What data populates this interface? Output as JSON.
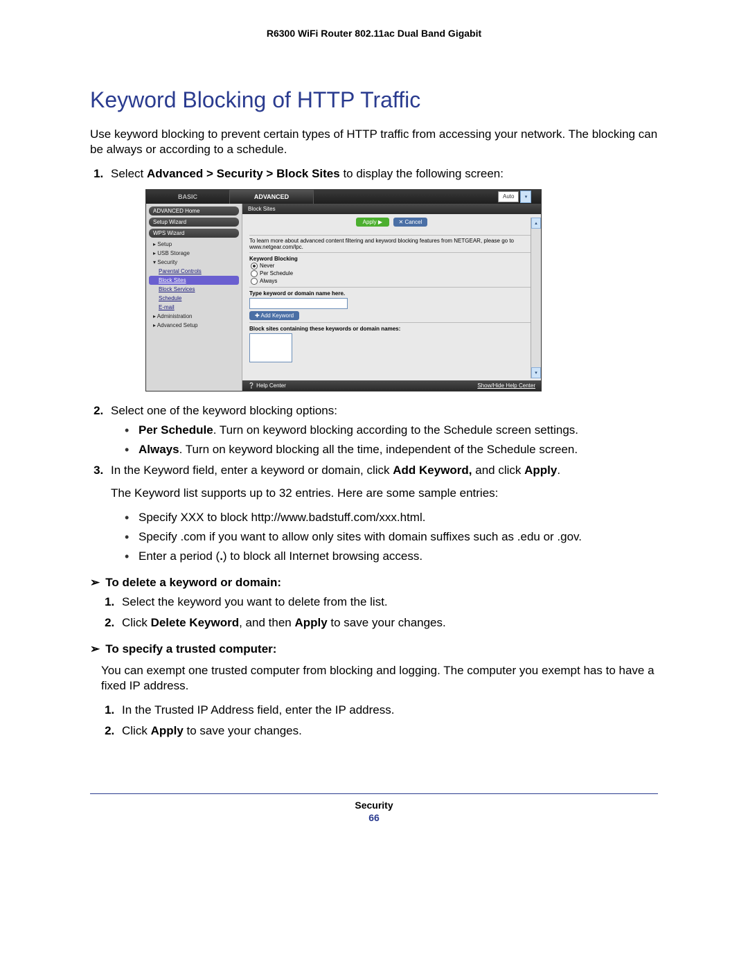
{
  "header": "R6300 WiFi Router 802.11ac Dual Band Gigabit",
  "title": "Keyword Blocking of HTTP Traffic",
  "intro": "Use keyword blocking to prevent certain types of HTTP traffic from accessing your network. The blocking can be always or according to a schedule.",
  "step1_pre": "Select ",
  "step1_bold": "Advanced > Security > Block Sites",
  "step1_post": " to display the following screen:",
  "step2": "Select one of the keyword blocking options:",
  "step2_b1_bold": "Per Schedule",
  "step2_b1_rest": ". Turn on keyword blocking according to the Schedule screen settings.",
  "step2_b2_bold": "Always",
  "step2_b2_rest": ". Turn on keyword blocking all the time, independent of the Schedule screen.",
  "step3_pre": "In the Keyword field, enter a keyword or domain, click ",
  "step3_b1": "Add Keyword,",
  "step3_mid": " and click ",
  "step3_b2": "Apply",
  "step3_post": ".",
  "step3_note": "The Keyword list supports up to 32 entries. Here are some sample entries:",
  "samples": [
    "Specify XXX to block http://www.badstuff.com/xxx.html.",
    "Specify .com if you want to allow only sites with domain suffixes such as .edu or .gov.",
    "Enter a period (.) to block all Internet browsing access."
  ],
  "proc_delete": "To delete a keyword or domain:",
  "del_step1": "Select the keyword you want to delete from the list.",
  "del_step2_pre": "Click ",
  "del_step2_b1": "Delete Keyword",
  "del_step2_mid": ", and then ",
  "del_step2_b2": "Apply",
  "del_step2_post": " to save your changes.",
  "proc_trusted": "To specify a trusted computer:",
  "trusted_intro": "You can exempt one trusted computer from blocking and logging. The computer you exempt has to have a fixed IP address.",
  "tr_step1": "In the Trusted IP Address field, enter the IP address.",
  "tr_step2_pre": "Click ",
  "tr_step2_b": "Apply",
  "tr_step2_post": " to save your changes.",
  "footer_section": "Security",
  "footer_page": "66",
  "shot": {
    "tab_basic": "BASIC",
    "tab_advanced": "ADVANCED",
    "auto": "Auto",
    "sidebar": {
      "adv_home": "ADVANCED Home",
      "setup_wiz": "Setup Wizard",
      "wps_wiz": "WPS Wizard",
      "setup": "▸ Setup",
      "usb": "▸ USB Storage",
      "security": "▾ Security",
      "parental": "Parental Controls",
      "block_sites": "Block Sites",
      "block_services": "Block Services",
      "schedule": "Schedule",
      "email": "E-mail",
      "admin": "▸ Administration",
      "adv_setup": "▸ Advanced Setup"
    },
    "main": {
      "title": "Block Sites",
      "apply": "Apply ▶",
      "cancel": "✕ Cancel",
      "learn": "To learn more about advanced content filtering and keyword blocking features from NETGEAR, please go to www.netgear.com/lpc.",
      "kw_blocking": "Keyword Blocking",
      "opt_never": "Never",
      "opt_sched": "Per Schedule",
      "opt_always": "Always",
      "type_label": "Type keyword or domain name here.",
      "add_kw": "✚ Add Keyword",
      "block_label": "Block sites containing these keywords or domain names:",
      "help_center": "❔ Help Center",
      "show_hide": "Show/Hide Help Center"
    }
  }
}
